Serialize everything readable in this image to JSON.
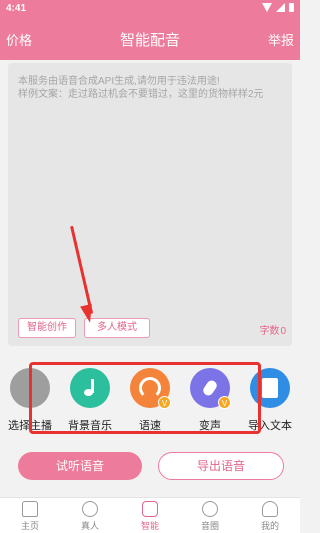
{
  "status": {
    "time": "4:41"
  },
  "appbar": {
    "left": "价格",
    "title": "智能配音",
    "right": "举报"
  },
  "editor": {
    "placeholder": "本服务由语音合成API生成,请勿用于违法用途!\n样例文案：走过路过机会不要错过，这里的货物样样2元",
    "ai_button": "智能创作",
    "multi_button": "多人模式",
    "count_label": "字数",
    "count_value": "0"
  },
  "tools": [
    {
      "label": "选择主播",
      "icon": "more-icon",
      "color": "#9e9e9e"
    },
    {
      "label": "背景音乐",
      "icon": "music-note-icon",
      "color": "#2bbf9d"
    },
    {
      "label": "语速",
      "icon": "speedometer-icon",
      "color": "#f3843a",
      "vip": "V"
    },
    {
      "label": "变声",
      "icon": "microphone-icon",
      "color": "#7b73e6",
      "vip": "V"
    },
    {
      "label": "导入文本",
      "icon": "document-icon",
      "color": "#2f8de4"
    }
  ],
  "actions": {
    "listen": "试听语音",
    "export": "导出语音"
  },
  "tabs": [
    {
      "label": "主页",
      "icon": "home-icon"
    },
    {
      "label": "真人",
      "icon": "person-icon"
    },
    {
      "label": "智能",
      "icon": "robot-icon",
      "active": true
    },
    {
      "label": "音圈",
      "icon": "ring-icon"
    },
    {
      "label": "我的",
      "icon": "me-icon"
    }
  ]
}
